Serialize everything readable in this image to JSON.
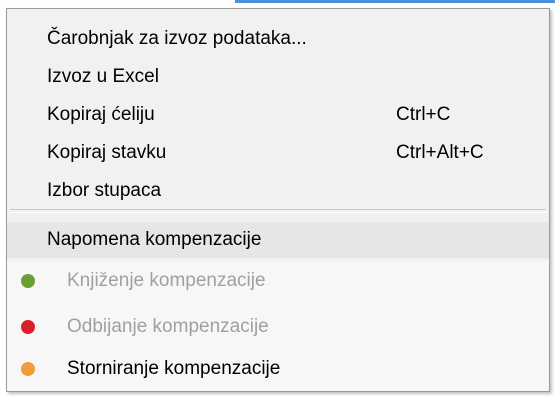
{
  "context_menu": {
    "items": [
      {
        "label": "Čarobnjak za izvoz podataka...",
        "shortcut": "",
        "enabled": true
      },
      {
        "label": "Izvoz u Excel",
        "shortcut": "",
        "enabled": true
      },
      {
        "label": "Kopiraj ćeliju",
        "shortcut": "Ctrl+C",
        "enabled": true
      },
      {
        "label": "Kopiraj stavku",
        "shortcut": "Ctrl+Alt+C",
        "enabled": true
      },
      {
        "label": "Izbor stupaca",
        "shortcut": "",
        "enabled": true
      }
    ],
    "highlighted_item": {
      "label": "Napomena kompenzacije",
      "enabled": true
    },
    "status_items": [
      {
        "label": "Knjiženje kompenzacije",
        "enabled": false,
        "icon": "green-dot-icon",
        "color": "#6aa032"
      },
      {
        "label": "Odbijanje kompenzacije",
        "enabled": false,
        "icon": "red-dot-icon",
        "color": "#d8202c"
      },
      {
        "label": "Storniranje kompenzacije",
        "enabled": true,
        "icon": "orange-dot-icon",
        "color": "#f39a3c"
      }
    ]
  }
}
